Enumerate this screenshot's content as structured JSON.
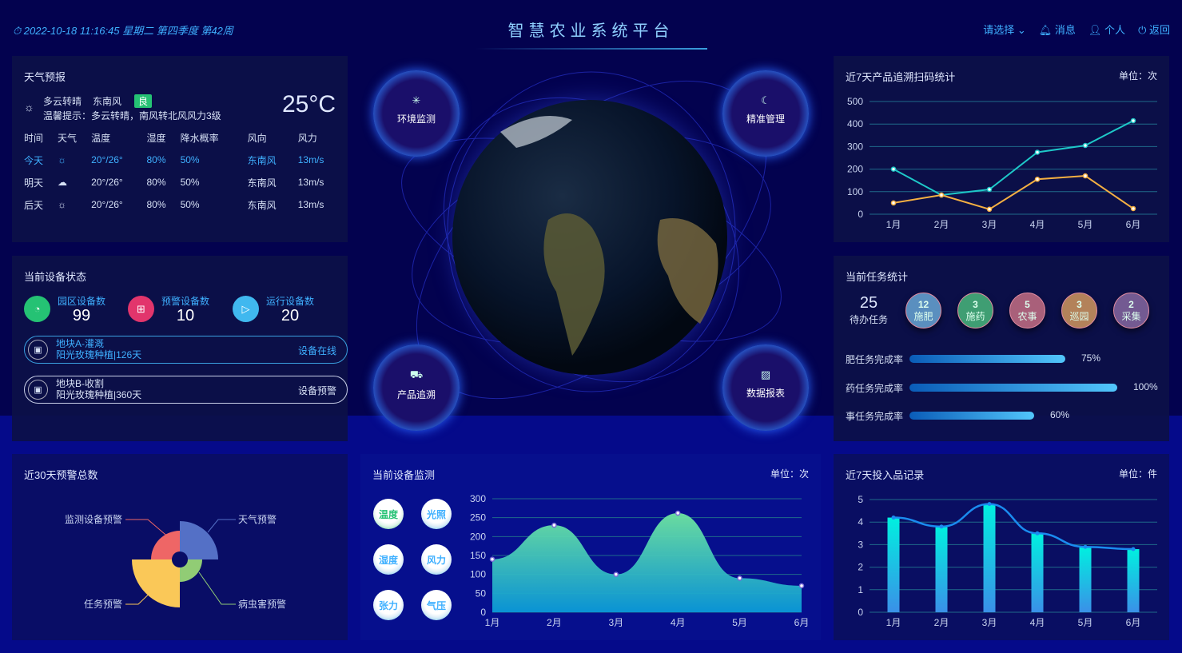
{
  "header": {
    "datetime": "2022-10-18 11:16:45 星期二 第四季度 第42周",
    "title": "智慧农业系统平台",
    "select": "请选择",
    "messages": "消息",
    "profile": "个人",
    "back": "返回"
  },
  "weather": {
    "title": "天气预报",
    "condition": "多云转晴",
    "wind": "东南风",
    "air_quality": "良",
    "tip": "温馨提示：多云转晴，南风转北风风力3级",
    "temperature": "25°C",
    "columns": [
      "时间",
      "天气",
      "温度",
      "湿度",
      "降水概率",
      "风向",
      "风力"
    ],
    "rows": [
      {
        "day": "今天",
        "icon": "sun",
        "temp": "20°/26°",
        "humidity": "80%",
        "rain": "50%",
        "dir": "东南风",
        "force": "13m/s"
      },
      {
        "day": "明天",
        "icon": "cloud-rain",
        "temp": "20°/26°",
        "humidity": "80%",
        "rain": "50%",
        "dir": "东南风",
        "force": "13m/s"
      },
      {
        "day": "后天",
        "icon": "sun",
        "temp": "20°/26°",
        "humidity": "80%",
        "rain": "50%",
        "dir": "东南风",
        "force": "13m/s"
      }
    ]
  },
  "devices": {
    "title": "当前设备状态",
    "stats": [
      {
        "label": "园区设备数",
        "value": "99",
        "color": "#25c274"
      },
      {
        "label": "预警设备数",
        "value": "10",
        "color": "#e2356c"
      },
      {
        "label": "运行设备数",
        "value": "20",
        "color": "#40b8ef"
      }
    ],
    "plots": [
      {
        "name": "地块A-灌溉",
        "crop": "阳光玫瑰种植|126天",
        "status": "设备在线"
      },
      {
        "name": "地块B-收割",
        "crop": "阳光玫瑰种植|360天",
        "status": "设备预警"
      }
    ]
  },
  "center": {
    "buttons": [
      "环境监测",
      "精准管理",
      "产品追溯",
      "数据报表"
    ]
  },
  "warnings": {
    "title": "近30天预警总数"
  },
  "monitor": {
    "title": "当前设备监测",
    "unit": "单位：次",
    "buttons": [
      "温度",
      "光照",
      "湿度",
      "风力",
      "张力",
      "气压"
    ]
  },
  "scan": {
    "title": "近7天产品追溯扫码统计",
    "unit": "单位：次"
  },
  "tasks": {
    "title": "当前任务统计",
    "pending": "25",
    "pending_label": "待办任务",
    "items": [
      {
        "count": "12",
        "label": "施肥",
        "color": "#5a8fbf"
      },
      {
        "count": "3",
        "label": "施药",
        "color": "#3f9e73"
      },
      {
        "count": "5",
        "label": "农事",
        "color": "#a9607a"
      },
      {
        "count": "3",
        "label": "巡园",
        "color": "#b3825a"
      },
      {
        "count": "2",
        "label": "采集",
        "color": "#735a92"
      }
    ],
    "rates": [
      {
        "label": "肥任务完成率",
        "value": 75,
        "text": "75%"
      },
      {
        "label": "药任务完成率",
        "value": 100,
        "text": "100%"
      },
      {
        "label": "事任务完成率",
        "value": 60,
        "text": "60%"
      }
    ]
  },
  "inputs": {
    "title": "近7天投入品记录",
    "unit": "单位：件"
  },
  "chart_data": [
    {
      "id": "scan",
      "type": "line",
      "categories": [
        "1月",
        "2月",
        "3月",
        "4月",
        "5月",
        "6月"
      ],
      "ylim": [
        0,
        500
      ],
      "yticks": [
        0,
        100,
        200,
        300,
        400,
        500
      ],
      "grid": true,
      "series": [
        {
          "values": [
            200,
            85,
            110,
            275,
            305,
            415
          ],
          "color": "#1ec8c8"
        },
        {
          "values": [
            50,
            85,
            22,
            155,
            170,
            25
          ],
          "color": "#f5b042"
        }
      ]
    },
    {
      "id": "monitor",
      "type": "area",
      "categories": [
        "1月",
        "2月",
        "3月",
        "4月",
        "5月",
        "6月"
      ],
      "ylim": [
        0,
        300
      ],
      "yticks": [
        0,
        50,
        100,
        150,
        200,
        250,
        300
      ],
      "grid": true,
      "series": [
        {
          "values": [
            140,
            230,
            100,
            262,
            90,
            70
          ]
        }
      ]
    },
    {
      "id": "inputs",
      "type": "bar",
      "categories": [
        "1月",
        "2月",
        "3月",
        "4月",
        "5月",
        "6月"
      ],
      "ylim": [
        0,
        5
      ],
      "yticks": [
        0,
        1,
        2,
        3,
        4,
        5
      ],
      "grid": true,
      "series": [
        {
          "type": "bar",
          "values": [
            4.2,
            3.8,
            4.8,
            3.5,
            2.9,
            2.8
          ]
        },
        {
          "type": "line",
          "values": [
            4.2,
            3.8,
            4.8,
            3.5,
            2.9,
            2.8
          ],
          "color": "#1a8cf0"
        }
      ]
    },
    {
      "id": "warnings",
      "type": "pie",
      "rose": true,
      "slices": [
        {
          "name": "天气预警",
          "value": 38,
          "color": "#5470c6"
        },
        {
          "name": "病虫害预警",
          "value": 18,
          "color": "#91cc75"
        },
        {
          "name": "任务预警",
          "value": 50,
          "color": "#fac858"
        },
        {
          "name": "监测设备预警",
          "value": 26,
          "color": "#ee6666"
        }
      ]
    }
  ]
}
